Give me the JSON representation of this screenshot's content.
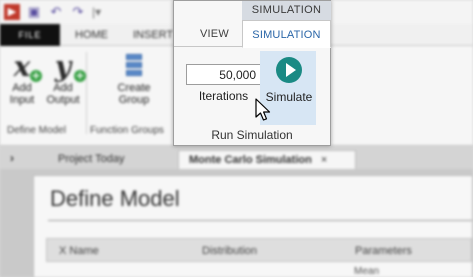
{
  "toolbar": {
    "qat_icons": [
      "app-icon",
      "save-icon",
      "undo-icon",
      "redo-icon"
    ],
    "tabs": {
      "file": "FILE",
      "home": "HOME",
      "insert": "INSERT"
    }
  },
  "ribbon": {
    "add_input": "Add\nInput",
    "add_output": "Add\nOutput",
    "create_group": "Create\nGroup",
    "group_define_model": "Define Model",
    "group_function_groups": "Function Groups"
  },
  "popup": {
    "context_tab": "SIMULATION",
    "tab_view": "VIEW",
    "tab_simulation": "SIMULATION",
    "iterations_value": "50,000",
    "iterations_label": "Iterations",
    "simulate_label": "Simulate",
    "group_label": "Run Simulation"
  },
  "document_tabs": {
    "project_today": "Project Today",
    "monte_carlo": "Monte Carlo Simulation",
    "close": "×"
  },
  "panel": {
    "title": "Define Model",
    "columns": [
      "X Name",
      "Distribution",
      "Parameters"
    ],
    "sub_cell": "Mean"
  },
  "colors": {
    "accent": "#2a66a8",
    "simulate_button_bg": "#d7e6f4",
    "play_icon": "#1a8a84",
    "file_tab": "#101010"
  }
}
